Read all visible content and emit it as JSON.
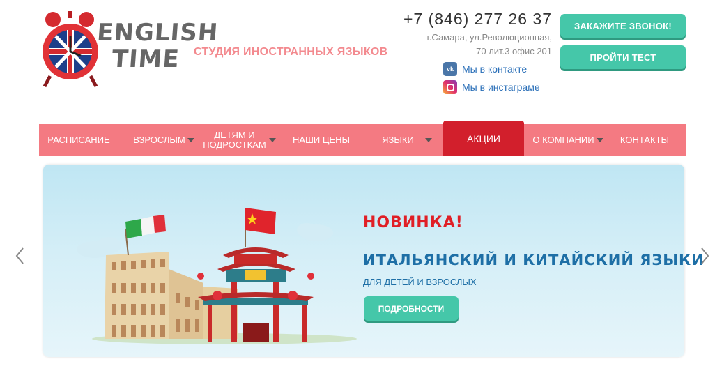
{
  "header": {
    "logo_line1": "ENGLISH",
    "logo_line2": "TIME",
    "tagline": "СТУДИЯ ИНОСТРАННЫХ ЯЗЫКОВ",
    "phone": "+7 (846) 277 26 37",
    "address_line1": "г.Самара, ул.Революционная,",
    "address_line2": "70 лит.3 офис 201",
    "social": [
      {
        "label": "Мы в контакте",
        "icon": "vk-icon",
        "icon_text": "vk"
      },
      {
        "label": "Мы в инстаграме",
        "icon": "instagram-icon"
      }
    ],
    "buttons": {
      "call": "ЗАКАЖИТЕ ЗВОНОК!",
      "test": "ПРОЙТИ ТЕСТ"
    }
  },
  "nav": {
    "items": [
      {
        "label": "РАСПИСАНИЕ"
      },
      {
        "label": "ВЗРОСЛЫМ"
      },
      {
        "label": "ДЕТЯМ И ПОДРОСТКАМ"
      },
      {
        "label": "НАШИ ЦЕНЫ"
      },
      {
        "label": "ЯЗЫКИ"
      },
      {
        "label": "АКЦИИ"
      },
      {
        "label": "О КОМПАНИИ"
      },
      {
        "label": "КОНТАКТЫ"
      }
    ]
  },
  "banner": {
    "new_label": "НОВИНКА!",
    "title": "ИТАЛЬЯНСКИЙ И КИТАЙСКИЙ ЯЗЫКИ",
    "subtitle": "ДЛЯ ДЕТЕЙ И ВЗРОСЛЫХ",
    "button": "ПОДРОБНОСТИ"
  },
  "colors": {
    "nav_bg": "#f47a82",
    "nav_active": "#d21f2c",
    "green_button": "#45c7a9",
    "tagline": "#f38a8f",
    "promo_red": "#e01f26",
    "promo_blue": "#1e6fa6"
  }
}
